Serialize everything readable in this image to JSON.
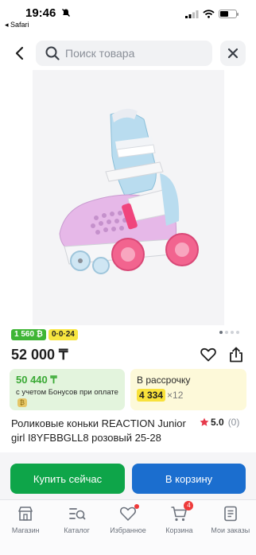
{
  "status_bar": {
    "time": "19:46",
    "back_app": "◂ Safari"
  },
  "search": {
    "placeholder": "Поиск товара"
  },
  "badges": {
    "bonus": "1 560 ₿",
    "installment": "0·0·24"
  },
  "product": {
    "price": "52 000 ₸",
    "title": "Роликовые коньки REACTION Junior girl I8YFBBGLL8 розовый 25-28",
    "rating": "5.0",
    "reviews": "(0)"
  },
  "bonus_card": {
    "amount": "50 440 ₸",
    "desc": "с учетом Бонусов при оплате",
    "coin": "₿"
  },
  "installment_card": {
    "title": "В рассрочку",
    "amount": "4 334",
    "multiplier": "×12"
  },
  "actions": {
    "buy_now": "Купить сейчас",
    "add_to_cart": "В корзину"
  },
  "tabs": [
    {
      "label": "Магазин",
      "icon": "shop-icon"
    },
    {
      "label": "Каталог",
      "icon": "catalog-icon"
    },
    {
      "label": "Избранное",
      "icon": "heart-icon"
    },
    {
      "label": "Корзина",
      "icon": "cart-icon",
      "badge": "4"
    },
    {
      "label": "Мои заказы",
      "icon": "orders-icon"
    }
  ],
  "colors": {
    "green": "#0ea549",
    "blue": "#1b6ecf",
    "badge_red": "#ee3b3b"
  }
}
